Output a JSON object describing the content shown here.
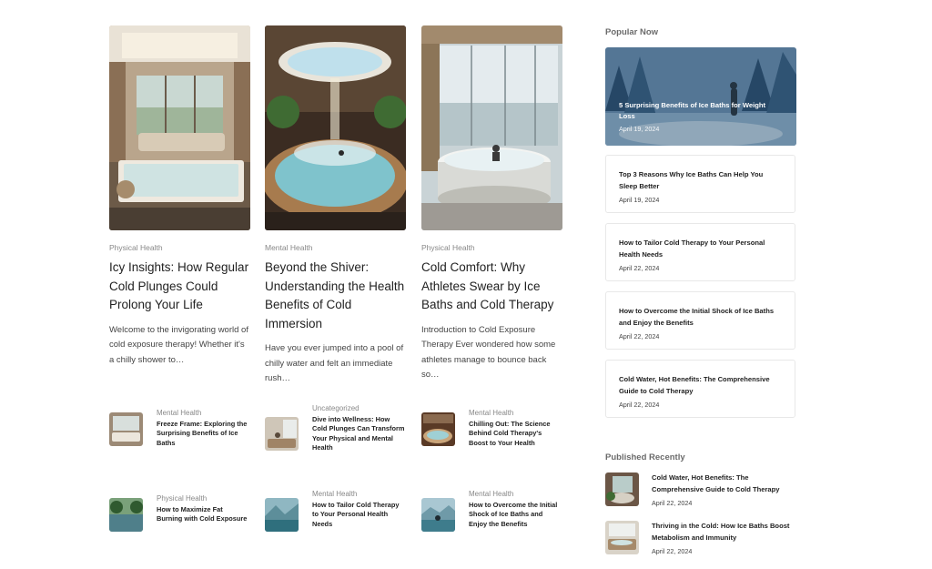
{
  "featured": [
    {
      "category": "Physical Health",
      "title": "Icy Insights: How Regular Cold Plunges Could Prolong Your Life",
      "excerpt": "Welcome to the invigorating world of cold exposure therapy! Whether it's a chilly shower to…"
    },
    {
      "category": "Mental Health",
      "title": "Beyond the Shiver: Understanding the Health Benefits of Cold Immersion",
      "excerpt": "Have you ever jumped into a pool of chilly water and felt an immediate rush…"
    },
    {
      "category": "Physical Health",
      "title": "Cold Comfort: Why Athletes Swear by Ice Baths and Cold Therapy",
      "excerpt": "Introduction to Cold Exposure Therapy Ever wondered how some athletes manage to bounce back so…"
    }
  ],
  "small_posts": [
    {
      "category": "Mental Health",
      "title": "Freeze Frame: Exploring the Surprising Benefits of Ice Baths"
    },
    {
      "category": "Uncategorized",
      "title": "Dive into Wellness: How Cold Plunges Can Transform Your Physical and Mental Health"
    },
    {
      "category": "Mental Health",
      "title": "Chilling Out: The Science Behind Cold Therapy's Boost to Your Health"
    },
    {
      "category": "Physical Health",
      "title": "How to Maximize Fat Burning with Cold Exposure"
    },
    {
      "category": "Mental Health",
      "title": "How to Tailor Cold Therapy to Your Personal Health Needs"
    },
    {
      "category": "Mental Health",
      "title": "How to Overcome the Initial Shock of Ice Baths and Enjoy the Benefits"
    }
  ],
  "sidebar": {
    "popular_heading": "Popular Now",
    "hero": {
      "title": "5 Surprising Benefits of Ice Baths for Weight Loss",
      "date": "April 19, 2024"
    },
    "popular": [
      {
        "title": "Top 3 Reasons Why Ice Baths Can Help You Sleep Better",
        "date": "April 19, 2024"
      },
      {
        "title": "How to Tailor Cold Therapy to Your Personal Health Needs",
        "date": "April 22, 2024"
      },
      {
        "title": "How to Overcome the Initial Shock of Ice Baths and Enjoy the Benefits",
        "date": "April 22, 2024"
      },
      {
        "title": "Cold Water, Hot Benefits: The Comprehensive Guide to Cold Therapy",
        "date": "April 22, 2024"
      }
    ],
    "recent_heading": "Published Recently",
    "recent": [
      {
        "title": "Cold Water, Hot Benefits: The Comprehensive Guide to Cold Therapy",
        "date": "April 22, 2024"
      },
      {
        "title": "Thriving in the Cold: How Ice Baths Boost Metabolism and Immunity",
        "date": "April 22, 2024"
      }
    ]
  }
}
